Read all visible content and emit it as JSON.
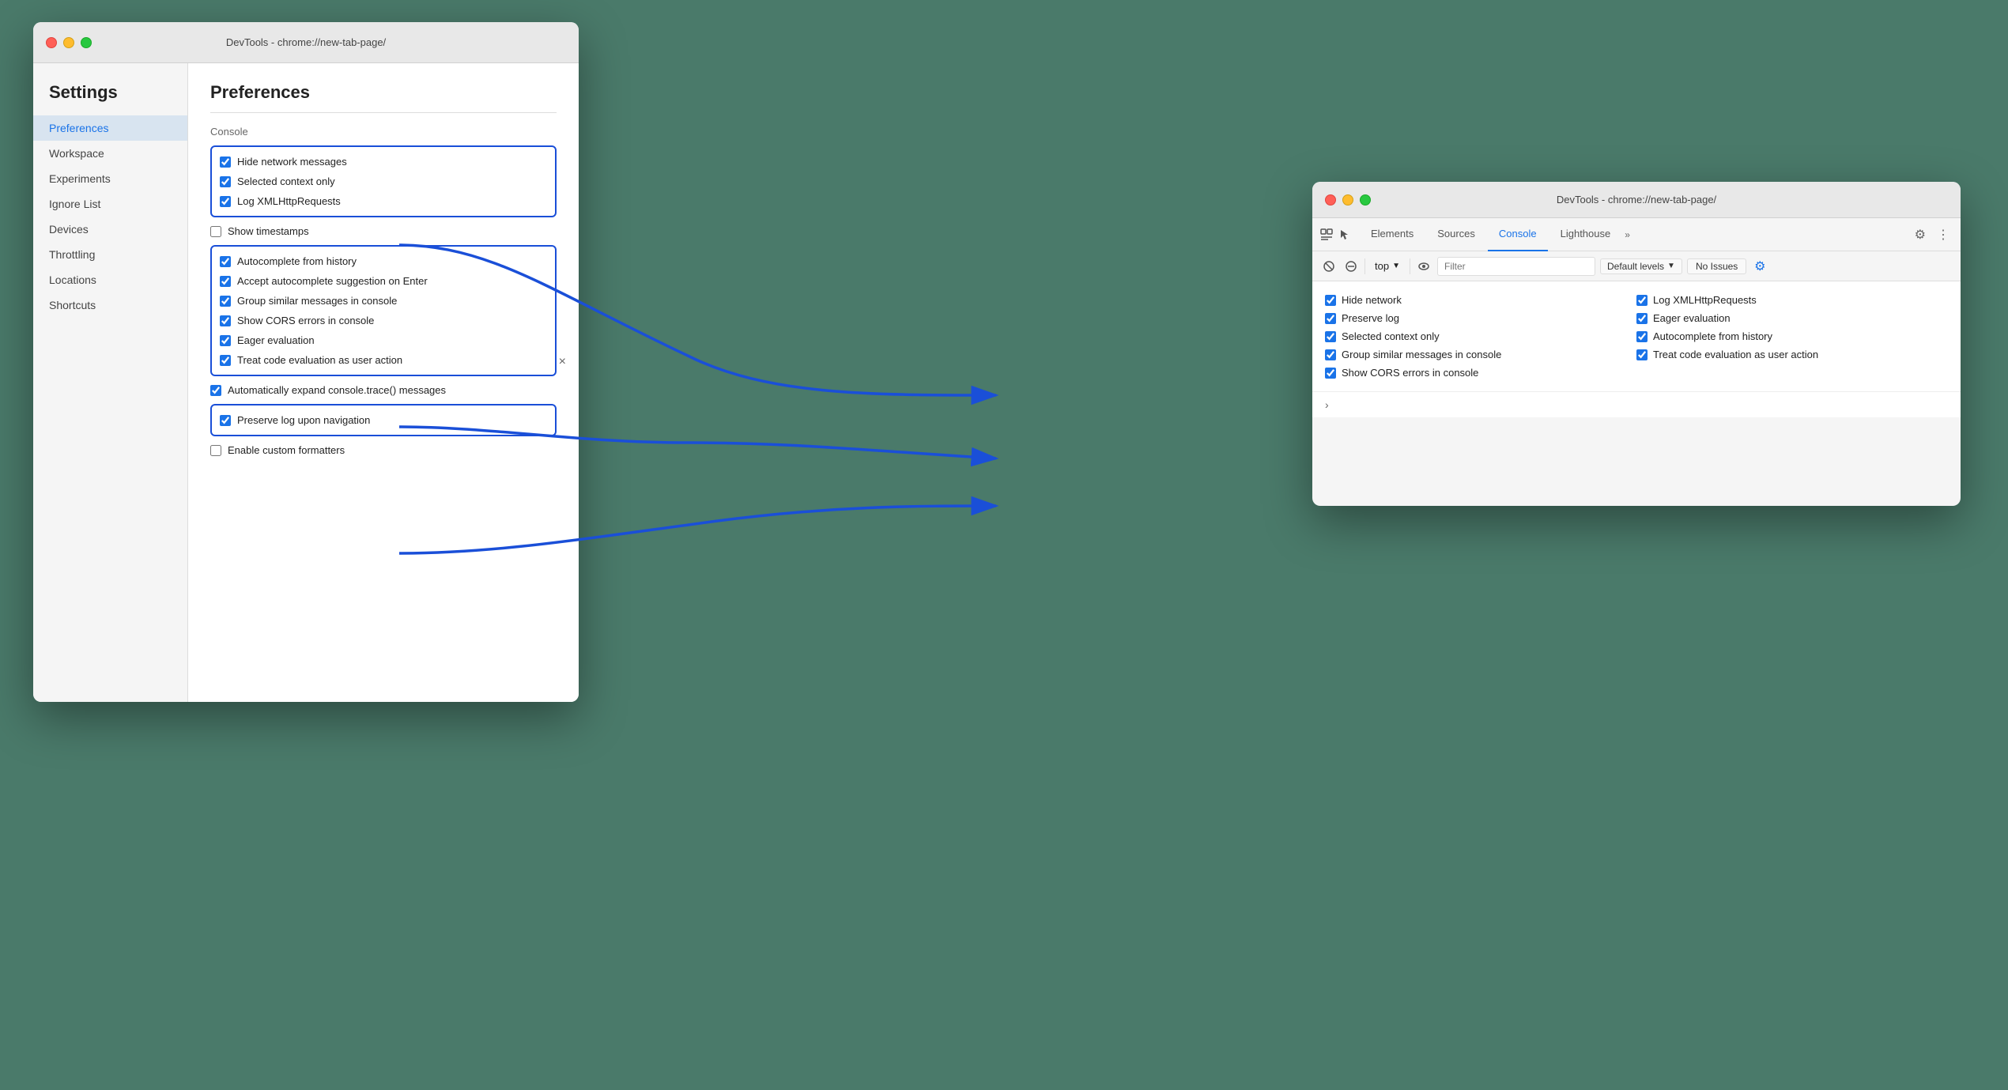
{
  "left_window": {
    "title_bar": {
      "text": "DevTools - chrome://new-tab-page/"
    },
    "close_btn": "×",
    "sidebar": {
      "heading": "Settings",
      "nav_items": [
        {
          "label": "Preferences",
          "active": true
        },
        {
          "label": "Workspace",
          "active": false
        },
        {
          "label": "Experiments",
          "active": false
        },
        {
          "label": "Ignore List",
          "active": false
        },
        {
          "label": "Devices",
          "active": false
        },
        {
          "label": "Throttling",
          "active": false
        },
        {
          "label": "Locations",
          "active": false
        },
        {
          "label": "Shortcuts",
          "active": false
        }
      ]
    },
    "content": {
      "heading": "Preferences",
      "section_console": "Console",
      "box1_items": [
        {
          "label": "Hide network messages",
          "checked": true
        },
        {
          "label": "Selected context only",
          "checked": true
        },
        {
          "label": "Log XMLHttpRequests",
          "checked": true
        }
      ],
      "show_timestamps": {
        "label": "Show timestamps",
        "checked": false
      },
      "box2_items": [
        {
          "label": "Autocomplete from history",
          "checked": true
        },
        {
          "label": "Accept autocomplete suggestion on Enter",
          "checked": true
        },
        {
          "label": "Group similar messages in console",
          "checked": true
        },
        {
          "label": "Show CORS errors in console",
          "checked": true
        },
        {
          "label": "Eager evaluation",
          "checked": true
        },
        {
          "label": "Treat code evaluation as user action",
          "checked": true
        }
      ],
      "standalone_item": {
        "label": "Automatically expand console.trace() messages",
        "checked": true
      },
      "box3_items": [
        {
          "label": "Preserve log upon navigation",
          "checked": true
        }
      ],
      "last_item": {
        "label": "Enable custom formatters",
        "checked": false
      }
    }
  },
  "right_window": {
    "title_bar": {
      "text": "DevTools - chrome://new-tab-page/"
    },
    "tabs": [
      {
        "label": "Elements",
        "active": false
      },
      {
        "label": "Sources",
        "active": false
      },
      {
        "label": "Console",
        "active": true
      },
      {
        "label": "Lighthouse",
        "active": false
      }
    ],
    "tab_more": "»",
    "toolbar": {
      "top_label": "top",
      "filter_placeholder": "Filter",
      "default_levels": "Default levels",
      "no_issues": "No Issues"
    },
    "console_items_left": [
      {
        "label": "Hide network",
        "checked": true
      },
      {
        "label": "Preserve log",
        "checked": true
      },
      {
        "label": "Selected context only",
        "checked": true
      },
      {
        "label": "Group similar messages in console",
        "checked": true
      },
      {
        "label": "Show CORS errors in console",
        "checked": true
      }
    ],
    "console_items_right": [
      {
        "label": "Log XMLHttpRequests",
        "checked": true
      },
      {
        "label": "Eager evaluation",
        "checked": true
      },
      {
        "label": "Autocomplete from history",
        "checked": true
      },
      {
        "label": "Treat code evaluation as user action",
        "checked": true
      }
    ]
  }
}
